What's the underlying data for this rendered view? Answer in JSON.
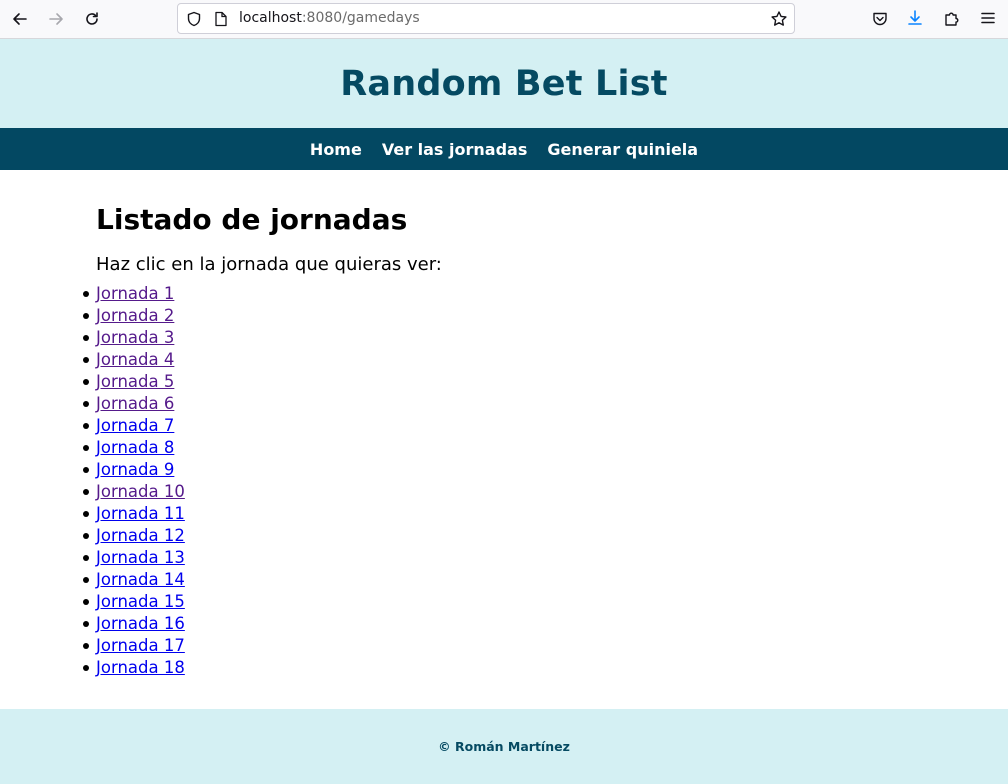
{
  "browser": {
    "url_host": "localhost",
    "url_rest": ":8080/gamedays"
  },
  "header": {
    "title": "Random Bet List"
  },
  "nav": {
    "home": "Home",
    "gamedays": "Ver las jornadas",
    "generate": "Generar quiniela"
  },
  "main": {
    "title": "Listado de jornadas",
    "intro": "Haz clic en la jornada que quieras ver:",
    "items": [
      {
        "label": "Jornada 1",
        "visited": true
      },
      {
        "label": "Jornada 2",
        "visited": true
      },
      {
        "label": "Jornada 3",
        "visited": true
      },
      {
        "label": "Jornada 4",
        "visited": true
      },
      {
        "label": "Jornada 5",
        "visited": true
      },
      {
        "label": "Jornada 6",
        "visited": true
      },
      {
        "label": "Jornada 7",
        "visited": false
      },
      {
        "label": "Jornada 8",
        "visited": false
      },
      {
        "label": "Jornada 9",
        "visited": false
      },
      {
        "label": "Jornada 10",
        "visited": true
      },
      {
        "label": "Jornada 11",
        "visited": false
      },
      {
        "label": "Jornada 12",
        "visited": false
      },
      {
        "label": "Jornada 13",
        "visited": false
      },
      {
        "label": "Jornada 14",
        "visited": false
      },
      {
        "label": "Jornada 15",
        "visited": false
      },
      {
        "label": "Jornada 16",
        "visited": false
      },
      {
        "label": "Jornada 17",
        "visited": false
      },
      {
        "label": "Jornada 18",
        "visited": false
      }
    ]
  },
  "footer": {
    "text": "© Román Martínez"
  },
  "colors": {
    "header_bg": "#d4f0f3",
    "nav_bg": "#034862",
    "title_color": "#054a62",
    "link": "#0000ee",
    "link_visited": "#551a8b"
  }
}
